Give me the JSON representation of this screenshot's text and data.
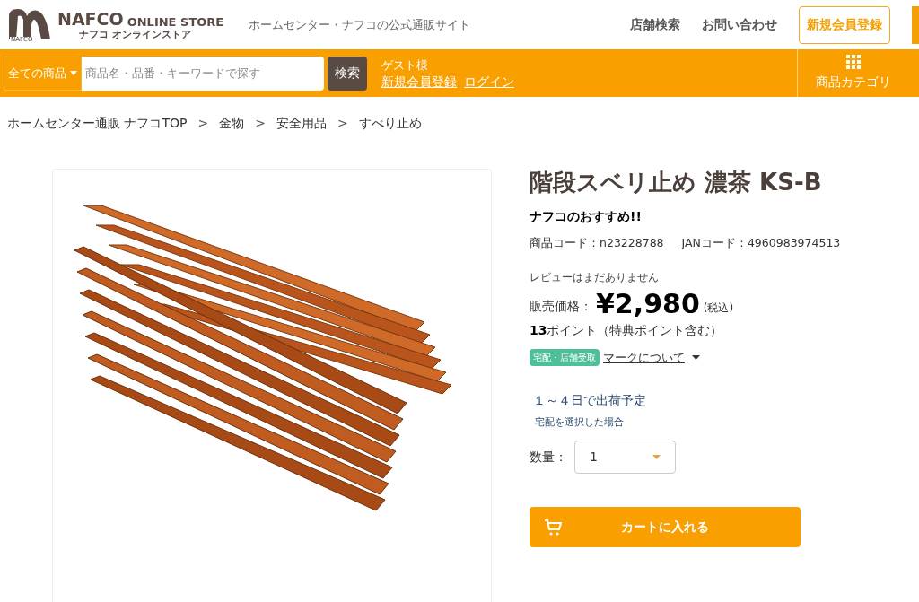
{
  "header": {
    "logo": {
      "mark": "NAFCO",
      "brand": "NAFCO",
      "brand_sub": "ONLINE STORE",
      "kana": "ナフコ オンラインストア"
    },
    "tagline": "ホームセンター・ナフコの公式通販サイト",
    "links": [
      "店舗検索",
      "お問い合わせ"
    ],
    "register_button": "新規会員登録"
  },
  "search_bar": {
    "category": "全ての商品",
    "placeholder": "商品名・品番・キーワードで探す",
    "button": "検索",
    "guest": "ゲスト様",
    "guest_links": [
      "新規会員登録",
      "ログイン"
    ],
    "category_menu": "商品カテゴリ"
  },
  "breadcrumbs": {
    "separator": ">",
    "items": [
      "ホームセンター通販 ナフコTOP",
      "金物",
      "安全用品",
      "すべり止め"
    ]
  },
  "product": {
    "title": "階段スベリ止め 濃茶 KS-B",
    "recommend": "ナフコのおすすめ!!",
    "code": "商品コード：n23228788",
    "jan": "JANコード：4960983974513",
    "reviews": "レビューはまだありません",
    "price_label": "販売価格：",
    "price": "¥2,980",
    "tax": "(税込)",
    "points_number": "13",
    "points_text": "ポイント（特典ポイント含む）",
    "badge": "宅配・店舗受取",
    "mark_link": "マークについて",
    "shipping": "１～４日で出荷予定",
    "shipping_note": "宅配を選択した場合",
    "quantity_label": "数量：",
    "quantity": "1",
    "cart_button": "カートに入れる"
  }
}
